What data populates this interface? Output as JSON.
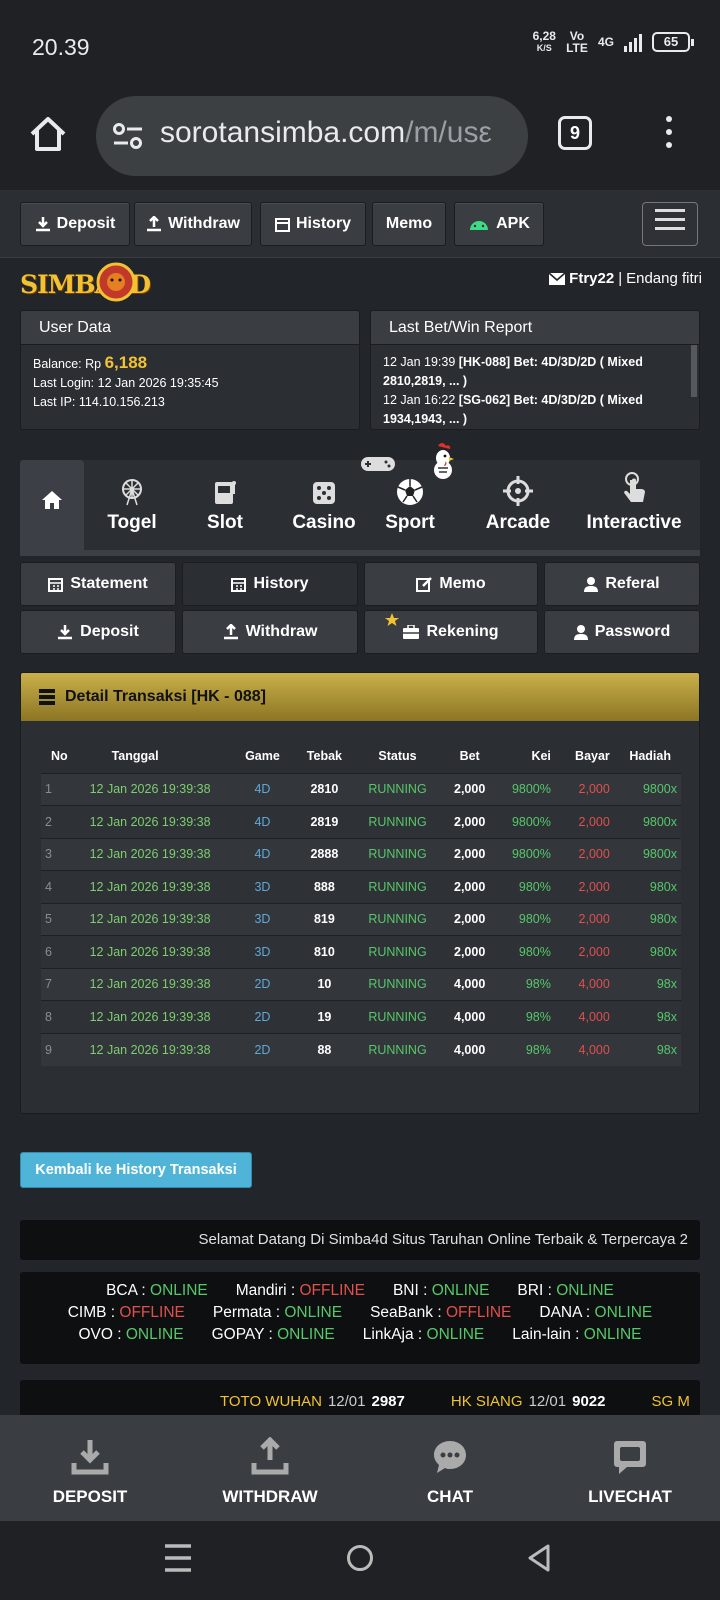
{
  "status_bar": {
    "time": "20.39",
    "speed_value": "6,28",
    "speed_unit": "K/S",
    "volte": "Vo LTE",
    "network": "4G",
    "battery": "65"
  },
  "browser": {
    "url_main": "sorotansimba.com",
    "url_path": "/m/usε",
    "tab_count": "9"
  },
  "topnav": {
    "deposit": "Deposit",
    "withdraw": "Withdraw",
    "history": "History",
    "memo": "Memo",
    "apk": "APK"
  },
  "brand": {
    "logo": "SIMBA4D",
    "username": "Ftry22",
    "separator": "|",
    "fullname": "Endang fitri"
  },
  "user_data": {
    "title": "User Data",
    "balance_label": "Balance: Rp",
    "balance_value": "6,188",
    "last_login": "Last Login: 12 Jan 2026 19:35:45",
    "last_ip": "Last IP: 114.10.156.213"
  },
  "last_bet": {
    "title": "Last Bet/Win Report",
    "items": [
      {
        "time": "12 Jan 19:39",
        "detail": "[HK-088] Bet: 4D/3D/2D ( Mixed 2810,2819, ... )"
      },
      {
        "time": "12 Jan 16:22",
        "detail": "[SG-062] Bet: 4D/3D/2D ( Mixed 1934,1943, ... )"
      }
    ]
  },
  "categories": [
    "Togel",
    "Slot",
    "Casino",
    "Sport",
    "Arcade",
    "Interactive"
  ],
  "sub_nav": {
    "statement": "Statement",
    "history": "History",
    "memo": "Memo",
    "referal": "Referal",
    "deposit": "Deposit",
    "withdraw": "Withdraw",
    "rekening": "Rekening",
    "password": "Password"
  },
  "detail": {
    "title": "Detail Transaksi [HK - 088]",
    "columns": [
      "No",
      "Tanggal",
      "Game",
      "Tebak",
      "Status",
      "Bet",
      "Kei",
      "Bayar",
      "Hadiah"
    ],
    "rows": [
      [
        "1",
        "12 Jan 2026 19:39:38",
        "4D",
        "2810",
        "RUNNING",
        "2,000",
        "9800%",
        "2,000",
        "9800x"
      ],
      [
        "2",
        "12 Jan 2026 19:39:38",
        "4D",
        "2819",
        "RUNNING",
        "2,000",
        "9800%",
        "2,000",
        "9800x"
      ],
      [
        "3",
        "12 Jan 2026 19:39:38",
        "4D",
        "2888",
        "RUNNING",
        "2,000",
        "9800%",
        "2,000",
        "9800x"
      ],
      [
        "4",
        "12 Jan 2026 19:39:38",
        "3D",
        "888",
        "RUNNING",
        "2,000",
        "980%",
        "2,000",
        "980x"
      ],
      [
        "5",
        "12 Jan 2026 19:39:38",
        "3D",
        "819",
        "RUNNING",
        "2,000",
        "980%",
        "2,000",
        "980x"
      ],
      [
        "6",
        "12 Jan 2026 19:39:38",
        "3D",
        "810",
        "RUNNING",
        "2,000",
        "980%",
        "2,000",
        "980x"
      ],
      [
        "7",
        "12 Jan 2026 19:39:38",
        "2D",
        "10",
        "RUNNING",
        "4,000",
        "98%",
        "4,000",
        "98x"
      ],
      [
        "8",
        "12 Jan 2026 19:39:38",
        "2D",
        "19",
        "RUNNING",
        "4,000",
        "98%",
        "4,000",
        "98x"
      ],
      [
        "9",
        "12 Jan 2026 19:39:38",
        "2D",
        "88",
        "RUNNING",
        "4,000",
        "98%",
        "4,000",
        "98x"
      ]
    ]
  },
  "back_button": "Kembali ke History Transaksi",
  "marquee": "Selamat Datang Di Simba4d Situs Taruhan Online Terbaik & Terpercaya 2",
  "banks": [
    [
      {
        "name": "BCA",
        "status": "ONLINE"
      },
      {
        "name": "Mandiri",
        "status": "OFFLINE"
      },
      {
        "name": "BNI",
        "status": "ONLINE"
      },
      {
        "name": "BRI",
        "status": "ONLINE"
      }
    ],
    [
      {
        "name": "CIMB",
        "status": "OFFLINE"
      },
      {
        "name": "Permata",
        "status": "ONLINE"
      },
      {
        "name": "SeaBank",
        "status": "OFFLINE"
      },
      {
        "name": "DANA",
        "status": "ONLINE"
      }
    ],
    [
      {
        "name": "OVO",
        "status": "ONLINE"
      },
      {
        "name": "GOPAY",
        "status": "ONLINE"
      },
      {
        "name": "LinkAja",
        "status": "ONLINE"
      },
      {
        "name": "Lain-lain",
        "status": "ONLINE"
      }
    ]
  ],
  "bank_separator": " : ",
  "results": [
    {
      "name": "TOTO WUHAN",
      "date": "12/01",
      "number": "2987"
    },
    {
      "name": "HK SIANG",
      "date": "12/01",
      "number": "9022"
    },
    {
      "name": "SG M",
      "date": "",
      "number": ""
    }
  ],
  "bottom_nav": {
    "deposit": "DEPOSIT",
    "withdraw": "WITHDRAW",
    "chat": "CHAT",
    "livechat": "LIVECHAT"
  },
  "colors": {
    "gold": "#f1c232",
    "online": "#56c86a",
    "offline": "#e0504d",
    "header_gold": "#c9b04a"
  }
}
